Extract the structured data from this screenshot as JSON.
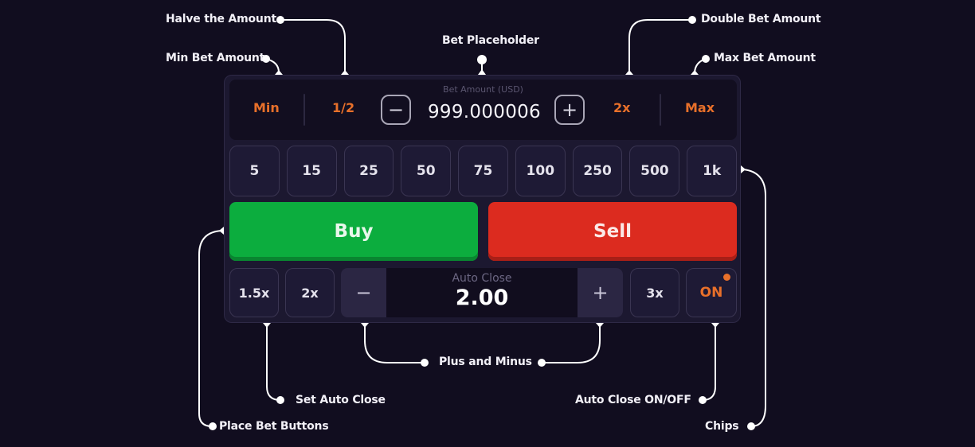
{
  "annotations": {
    "halve": "Halve the Amount",
    "min": "Min Bet Amount",
    "placeholder": "Bet Placeholder",
    "double": "Double Bet Amount",
    "max": "Max Bet Amount",
    "plus_minus": "Plus and Minus",
    "set_auto_close": "Set Auto Close",
    "place_bet": "Place Bet Buttons",
    "auto_close_toggle": "Auto Close ON/OFF",
    "chips": "Chips"
  },
  "bet": {
    "label": "Bet Amount (USD)",
    "value": "999.000006",
    "min_label": "Min",
    "half_label": "1/2",
    "double_label": "2x",
    "max_label": "Max",
    "minus_icon": "−",
    "plus_icon": "+"
  },
  "chips": [
    "5",
    "15",
    "25",
    "50",
    "75",
    "100",
    "250",
    "500",
    "1k"
  ],
  "trade": {
    "buy_label": "Buy",
    "sell_label": "Sell"
  },
  "auto_close": {
    "label": "Auto Close",
    "value": "2.00",
    "preset_1": "1.5x",
    "preset_2": "2x",
    "preset_3": "3x",
    "minus_icon": "−",
    "plus_icon": "+",
    "toggle_label": "ON"
  },
  "colors": {
    "background": "#110d1f",
    "accent": "#e8702a",
    "buy": "#0cad3e",
    "sell": "#dc2b1f"
  }
}
